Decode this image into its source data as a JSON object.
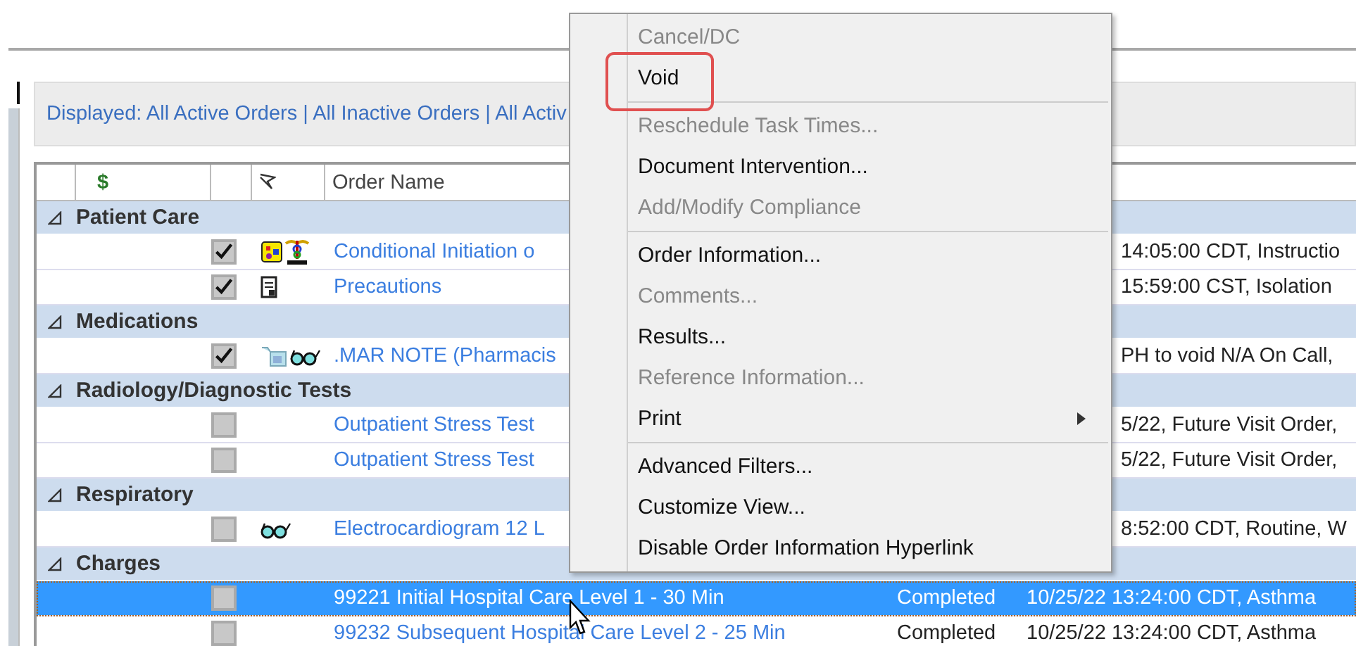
{
  "filter_bar": {
    "text": "Displayed: All Active Orders | All Inactive Orders | All Activ"
  },
  "table": {
    "columns": [
      {
        "kind": "dollar",
        "label": "$"
      },
      {
        "kind": "flag"
      },
      {
        "kind": "text",
        "label": "Order Name"
      }
    ],
    "groups": [
      {
        "name": "Patient Care",
        "expanded": true,
        "rows": [
          {
            "checked": true,
            "selected": false,
            "icons": [
              {
                "kind": "grid"
              },
              {
                "kind": "caduceus"
              }
            ],
            "order_name": "Conditional Initiation o",
            "details": "14:05:00 CDT, Instructio"
          },
          {
            "checked": true,
            "selected": false,
            "icons": [
              {
                "kind": "document"
              }
            ],
            "order_name": "Precautions",
            "details": "15:59:00 CST, Isolation"
          }
        ]
      },
      {
        "name": "Medications",
        "expanded": true,
        "rows": [
          {
            "checked": true,
            "selected": false,
            "icons": [
              {
                "kind": "bottle"
              },
              {
                "kind": "glasses"
              }
            ],
            "order_name": ".MAR NOTE (Pharmacis",
            "details": "PH to void N/A On Call,"
          }
        ]
      },
      {
        "name": "Radiology/Diagnostic Tests",
        "expanded": true,
        "rows": [
          {
            "checked": false,
            "selected": false,
            "icons": [],
            "order_name": "Outpatient Stress Test",
            "details": "5/22, Future Visit Order,"
          },
          {
            "checked": false,
            "selected": false,
            "icons": [],
            "order_name": "Outpatient Stress Test",
            "details": "5/22, Future Visit Order,"
          }
        ]
      },
      {
        "name": "Respiratory",
        "expanded": true,
        "rows": [
          {
            "checked": false,
            "selected": false,
            "icons": [
              {
                "kind": "glasses"
              }
            ],
            "order_name": "Electrocardiogram 12 L",
            "details": "8:52:00 CDT, Routine, W"
          }
        ]
      },
      {
        "name": "Charges",
        "expanded": true,
        "rows": [
          {
            "checked": false,
            "selected": true,
            "icons": [],
            "order_name": "99221 Initial Hospital Care Level 1 - 30 Min",
            "status": "Completed",
            "details": "10/25/22 13:24:00 CDT, Asthma"
          },
          {
            "checked": false,
            "selected": false,
            "icons": [],
            "order_name": "99232 Subsequent Hospital Care Level 2 - 25 Min",
            "status": "Completed",
            "details": "10/25/22 13:24:00 CDT, Asthma"
          }
        ]
      }
    ]
  },
  "context_menu": {
    "sections": [
      [
        {
          "label": "Cancel/DC",
          "disabled": true,
          "highlighted": false,
          "submenu": false
        },
        {
          "label": "Void",
          "disabled": false,
          "highlighted": true,
          "submenu": false
        }
      ],
      [
        {
          "label": "Reschedule Task Times...",
          "disabled": true,
          "highlighted": false,
          "submenu": false
        },
        {
          "label": "Document Intervention...",
          "disabled": false,
          "highlighted": false,
          "submenu": false
        },
        {
          "label": "Add/Modify Compliance",
          "disabled": true,
          "highlighted": false,
          "submenu": false
        }
      ],
      [
        {
          "label": "Order Information...",
          "disabled": false,
          "highlighted": false,
          "submenu": false
        },
        {
          "label": "Comments...",
          "disabled": true,
          "highlighted": false,
          "submenu": false
        },
        {
          "label": "Results...",
          "disabled": false,
          "highlighted": false,
          "submenu": false
        },
        {
          "label": "Reference Information...",
          "disabled": true,
          "highlighted": false,
          "submenu": false
        },
        {
          "label": "Print",
          "disabled": false,
          "highlighted": false,
          "submenu": true
        }
      ],
      [
        {
          "label": "Advanced Filters...",
          "disabled": false,
          "highlighted": false,
          "submenu": false
        },
        {
          "label": "Customize View...",
          "disabled": false,
          "highlighted": false,
          "submenu": false
        },
        {
          "label": "Disable Order Information Hyperlink",
          "disabled": false,
          "highlighted": false,
          "submenu": false
        }
      ]
    ]
  }
}
